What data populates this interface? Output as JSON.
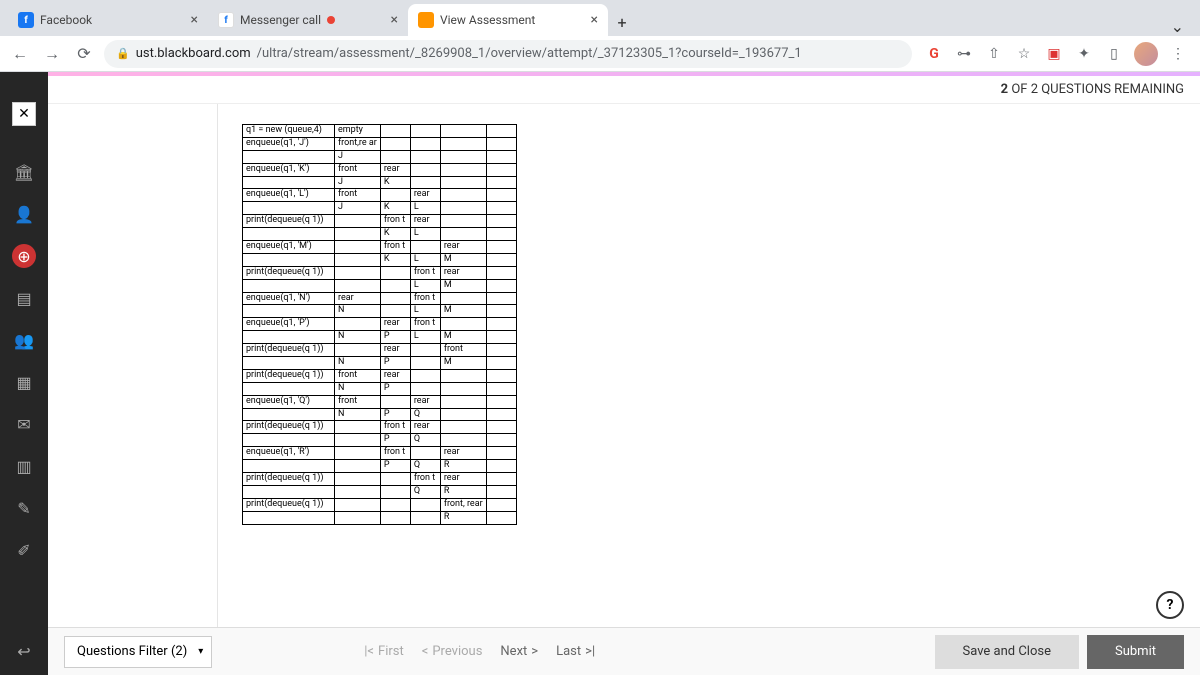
{
  "browser": {
    "tabs": [
      {
        "label": "Facebook",
        "favicon_bg": "#1877f2",
        "favicon_text": "f",
        "favicon_color": "#fff"
      },
      {
        "label": "Messenger call",
        "favicon_bg": "#fff",
        "favicon_text": "f",
        "favicon_color": "#1877f2",
        "recording": true
      },
      {
        "label": "View Assessment",
        "favicon_bg": "#ff9500",
        "favicon_text": "",
        "favicon_color": "#fff",
        "active": true
      }
    ],
    "url_domain": "ust.blackboard.com",
    "url_path": "/ultra/stream/assessment/_8269908_1/overview/attempt/_37123305_1?courseId=_193677_1"
  },
  "progress": {
    "current": "2",
    "word": "OF",
    "total": "2",
    "suffix": "QUESTIONS REMAINING"
  },
  "table_rows": [
    [
      {
        "t": "q1 = new (queue,4)",
        "cls": "op"
      },
      {
        "t": "empty"
      },
      {
        "t": ""
      },
      {
        "t": ""
      },
      {
        "t": ""
      },
      {
        "t": ""
      }
    ],
    [
      {
        "t": "enqueue(q1, 'J')",
        "cls": "op"
      },
      {
        "t": "front,re ar"
      },
      {
        "t": ""
      },
      {
        "t": ""
      },
      {
        "t": ""
      },
      {
        "t": ""
      }
    ],
    [
      {
        "t": "",
        "cls": "op"
      },
      {
        "t": "J"
      },
      {
        "t": ""
      },
      {
        "t": ""
      },
      {
        "t": ""
      },
      {
        "t": ""
      }
    ],
    [
      {
        "t": "enqueue(q1, 'K')",
        "cls": "op"
      },
      {
        "t": "front"
      },
      {
        "t": "rear"
      },
      {
        "t": ""
      },
      {
        "t": ""
      },
      {
        "t": ""
      }
    ],
    [
      {
        "t": "",
        "cls": "op"
      },
      {
        "t": "J"
      },
      {
        "t": "K"
      },
      {
        "t": ""
      },
      {
        "t": ""
      },
      {
        "t": ""
      }
    ],
    [
      {
        "t": "enqueue(q1, 'L')",
        "cls": "op"
      },
      {
        "t": "front"
      },
      {
        "t": ""
      },
      {
        "t": "rear"
      },
      {
        "t": ""
      },
      {
        "t": ""
      }
    ],
    [
      {
        "t": "",
        "cls": "op"
      },
      {
        "t": "J"
      },
      {
        "t": "K"
      },
      {
        "t": "L"
      },
      {
        "t": ""
      },
      {
        "t": ""
      }
    ],
    [
      {
        "t": "print(dequeue(q 1))",
        "cls": "op"
      },
      {
        "t": ""
      },
      {
        "t": "fron t"
      },
      {
        "t": "rear"
      },
      {
        "t": ""
      },
      {
        "t": ""
      }
    ],
    [
      {
        "t": "",
        "cls": "op"
      },
      {
        "t": ""
      },
      {
        "t": "K"
      },
      {
        "t": "L"
      },
      {
        "t": ""
      },
      {
        "t": ""
      }
    ],
    [
      {
        "t": "enqueue(q1, 'M')",
        "cls": "op"
      },
      {
        "t": ""
      },
      {
        "t": "fron t"
      },
      {
        "t": ""
      },
      {
        "t": "rear"
      },
      {
        "t": ""
      }
    ],
    [
      {
        "t": "",
        "cls": "op"
      },
      {
        "t": ""
      },
      {
        "t": "K"
      },
      {
        "t": "L"
      },
      {
        "t": "M"
      },
      {
        "t": ""
      }
    ],
    [
      {
        "t": "print(dequeue(q 1))",
        "cls": "op"
      },
      {
        "t": ""
      },
      {
        "t": ""
      },
      {
        "t": "fron t"
      },
      {
        "t": "rear"
      },
      {
        "t": ""
      }
    ],
    [
      {
        "t": "",
        "cls": "op"
      },
      {
        "t": ""
      },
      {
        "t": ""
      },
      {
        "t": "L"
      },
      {
        "t": "M"
      },
      {
        "t": ""
      }
    ],
    [
      {
        "t": "enqueue(q1, 'N')",
        "cls": "op"
      },
      {
        "t": "rear"
      },
      {
        "t": ""
      },
      {
        "t": "fron t"
      },
      {
        "t": ""
      },
      {
        "t": ""
      }
    ],
    [
      {
        "t": "",
        "cls": "op"
      },
      {
        "t": "N"
      },
      {
        "t": ""
      },
      {
        "t": "L"
      },
      {
        "t": "M"
      },
      {
        "t": ""
      }
    ],
    [
      {
        "t": "enqueue(q1, 'P')",
        "cls": "op"
      },
      {
        "t": ""
      },
      {
        "t": "rear"
      },
      {
        "t": "fron t"
      },
      {
        "t": ""
      },
      {
        "t": ""
      }
    ],
    [
      {
        "t": "",
        "cls": "op"
      },
      {
        "t": "N"
      },
      {
        "t": "P"
      },
      {
        "t": "L"
      },
      {
        "t": "M"
      },
      {
        "t": ""
      }
    ],
    [
      {
        "t": "print(dequeue(q 1))",
        "cls": "op"
      },
      {
        "t": ""
      },
      {
        "t": "rear"
      },
      {
        "t": ""
      },
      {
        "t": "front"
      },
      {
        "t": ""
      }
    ],
    [
      {
        "t": "",
        "cls": "op"
      },
      {
        "t": "N"
      },
      {
        "t": "P"
      },
      {
        "t": ""
      },
      {
        "t": "M"
      },
      {
        "t": ""
      }
    ],
    [
      {
        "t": "print(dequeue(q 1))",
        "cls": "op"
      },
      {
        "t": "front"
      },
      {
        "t": "rear"
      },
      {
        "t": ""
      },
      {
        "t": ""
      },
      {
        "t": ""
      }
    ],
    [
      {
        "t": "",
        "cls": "op"
      },
      {
        "t": "N"
      },
      {
        "t": "P"
      },
      {
        "t": ""
      },
      {
        "t": ""
      },
      {
        "t": ""
      }
    ],
    [
      {
        "t": "enqueue(q1, 'Q')",
        "cls": "op"
      },
      {
        "t": "front"
      },
      {
        "t": ""
      },
      {
        "t": "rear"
      },
      {
        "t": ""
      },
      {
        "t": ""
      }
    ],
    [
      {
        "t": "",
        "cls": "op"
      },
      {
        "t": "N"
      },
      {
        "t": "P"
      },
      {
        "t": "Q"
      },
      {
        "t": ""
      },
      {
        "t": ""
      }
    ],
    [
      {
        "t": "print(dequeue(q 1))",
        "cls": "op"
      },
      {
        "t": ""
      },
      {
        "t": "fron t"
      },
      {
        "t": "rear"
      },
      {
        "t": ""
      },
      {
        "t": ""
      }
    ],
    [
      {
        "t": "",
        "cls": "op"
      },
      {
        "t": ""
      },
      {
        "t": "P"
      },
      {
        "t": "Q"
      },
      {
        "t": ""
      },
      {
        "t": ""
      }
    ],
    [
      {
        "t": "enqueue(q1, 'R')",
        "cls": "op"
      },
      {
        "t": ""
      },
      {
        "t": "fron t"
      },
      {
        "t": ""
      },
      {
        "t": "rear"
      },
      {
        "t": ""
      }
    ],
    [
      {
        "t": "",
        "cls": "op"
      },
      {
        "t": ""
      },
      {
        "t": "P"
      },
      {
        "t": "Q"
      },
      {
        "t": "R"
      },
      {
        "t": ""
      }
    ],
    [
      {
        "t": "print(dequeue(q 1))",
        "cls": "op"
      },
      {
        "t": ""
      },
      {
        "t": ""
      },
      {
        "t": "fron t"
      },
      {
        "t": "rear"
      },
      {
        "t": ""
      }
    ],
    [
      {
        "t": "",
        "cls": "op"
      },
      {
        "t": ""
      },
      {
        "t": ""
      },
      {
        "t": "Q"
      },
      {
        "t": "R"
      },
      {
        "t": ""
      }
    ],
    [
      {
        "t": "print(dequeue(q 1))",
        "cls": "op"
      },
      {
        "t": ""
      },
      {
        "t": ""
      },
      {
        "t": ""
      },
      {
        "t": "front, rear"
      },
      {
        "t": ""
      }
    ],
    [
      {
        "t": "",
        "cls": "op"
      },
      {
        "t": ""
      },
      {
        "t": ""
      },
      {
        "t": ""
      },
      {
        "t": "R"
      },
      {
        "t": ""
      }
    ]
  ],
  "footer": {
    "filter": "Questions Filter (2)",
    "first": "First",
    "previous": "Previous",
    "next": "Next",
    "last": "Last",
    "save": "Save and Close",
    "submit": "Submit"
  },
  "help_icon": "?"
}
